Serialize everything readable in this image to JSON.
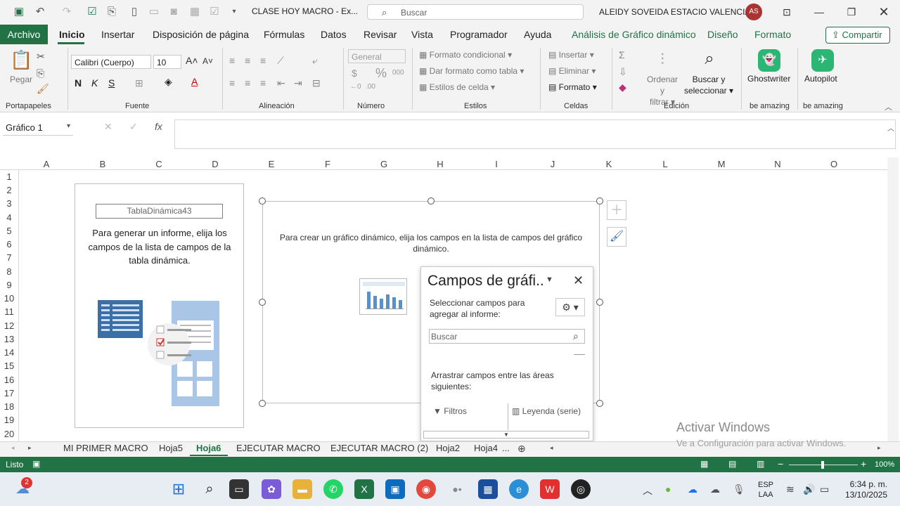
{
  "titlebar": {
    "doc_title": "CLASE HOY MACRO  -  Ex...",
    "search_placeholder": "Buscar",
    "user_name": "ALEIDY SOVEIDA ESTACIO VALENCIA",
    "avatar_initials": "AS"
  },
  "menu": {
    "file": "Archivo",
    "tabs": [
      "Inicio",
      "Insertar",
      "Disposición de página",
      "Fórmulas",
      "Datos",
      "Revisar",
      "Vista",
      "Programador",
      "Ayuda"
    ],
    "context_tabs": [
      "Análisis de Gráfico dinámico",
      "Diseño",
      "Formato"
    ],
    "share": "Compartir"
  },
  "ribbon": {
    "paste": "Pegar",
    "font_name": "Calibri (Cuerpo)",
    "font_size": "10",
    "number_format": "General",
    "cond_format": "Formato condicional",
    "table_format": "Dar formato como tabla",
    "cell_styles": "Estilos de celda",
    "insert": "Insertar",
    "delete": "Eliminar",
    "format": "Formato",
    "sort_filter_1": "Ordenar y",
    "sort_filter_2": "filtrar",
    "find_1": "Buscar y",
    "find_2": "seleccionar",
    "ghostwriter": "Ghostwriter",
    "autopilot": "Autopilot",
    "groups": [
      "Portapapeles",
      "Fuente",
      "Alineación",
      "Número",
      "Estilos",
      "Celdas",
      "Edición",
      "be amazing",
      "be amazing"
    ]
  },
  "formula_bar": {
    "name_box": "Gráfico 1",
    "fx": "fx"
  },
  "grid": {
    "columns": [
      "A",
      "B",
      "C",
      "D",
      "E",
      "F",
      "G",
      "H",
      "I",
      "J",
      "K",
      "L",
      "M",
      "N",
      "O"
    ],
    "rows": [
      "1",
      "2",
      "3",
      "4",
      "5",
      "6",
      "7",
      "8",
      "9",
      "10",
      "11",
      "12",
      "13",
      "14",
      "15",
      "16",
      "17",
      "18",
      "19",
      "20"
    ]
  },
  "pivot": {
    "name": "TablaDinámica43",
    "message": "Para generar un informe, elija los campos de la lista de campos de la tabla dinámica."
  },
  "chart": {
    "message": "Para crear un gráfico dinámico, elija los campos en la lista de campos del gráfico dinámico."
  },
  "field_pane": {
    "title": "Campos de gráfi..",
    "select_text": "Seleccionar campos para agregar al informe:",
    "search_placeholder": "Buscar",
    "drag_text": "Arrastrar campos entre las áreas siguientes:",
    "filters": "Filtros",
    "legend": "Leyenda (serie)"
  },
  "sheets": {
    "tabs": [
      "MI PRIMER MACRO",
      "Hoja5",
      "Hoja6",
      "EJECUTAR MACRO",
      "EJECUTAR MACRO (2)",
      "Hoja2",
      "Hoja4"
    ],
    "more": "...",
    "active": "Hoja6"
  },
  "watermark": {
    "line1": "Activar Windows",
    "line2": "Ve a Configuración para activar Windows."
  },
  "status": {
    "text": "Listo",
    "zoom": "100%"
  },
  "taskbar": {
    "weather_badge": "2",
    "lang_1": "ESP",
    "lang_2": "LAA",
    "time": "6:34 p. m.",
    "date": "13/10/2025"
  },
  "colors": {
    "accent": "#217346"
  }
}
